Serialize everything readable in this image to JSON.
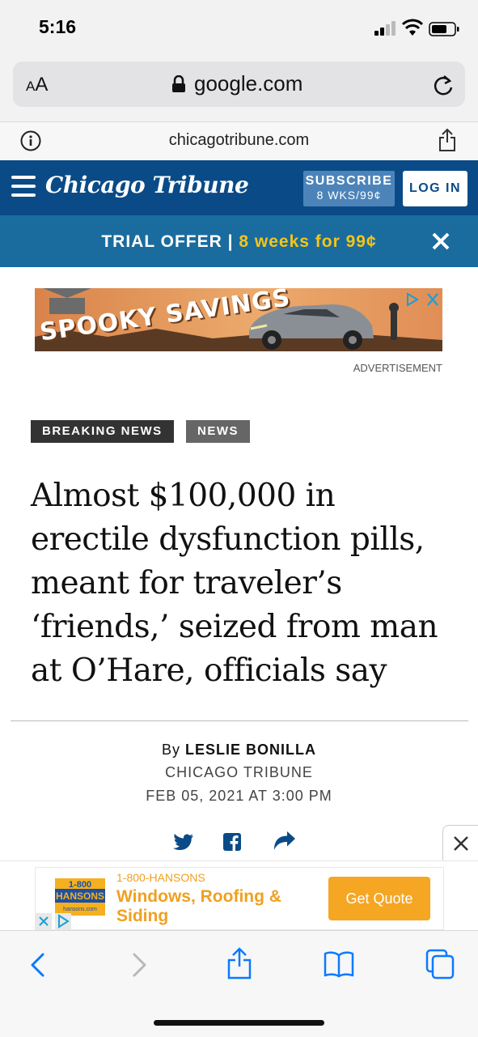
{
  "status_bar": {
    "time": "5:16"
  },
  "address_bar": {
    "aa_label_small": "A",
    "aa_label_large": "A",
    "url": "google.com"
  },
  "site_bar": {
    "host": "chicagotribune.com"
  },
  "header": {
    "logo": "Chicago Tribune",
    "subscribe_line1": "SUBSCRIBE",
    "subscribe_line2": "8 WKS/99¢",
    "login_label": "LOG IN"
  },
  "trial_bar": {
    "label": "TRIAL OFFER",
    "separator": " | ",
    "offer": "8 weeks for 99¢"
  },
  "ad_top": {
    "headline": "SPOOKY SAVINGS",
    "label": "ADVERTISEMENT"
  },
  "tags": [
    "BREAKING NEWS",
    "NEWS"
  ],
  "article": {
    "headline": "Almost $100,000 in erectile dysfunction pills, meant for traveler’s ‘friends,’ seized from man at O’Hare, officials say",
    "byline_prefix": "By ",
    "author": "LESLIE BONILLA",
    "publisher": "CHICAGO TRIBUNE",
    "date": "FEB 05, 2021 AT 3:00 PM"
  },
  "sticky_ad": {
    "small_text": "1-800-HANSONS",
    "title": "Windows, Roofing & Siding",
    "cta": "Get Quote",
    "logo_line1": "1-800",
    "logo_line2": "HANSONS",
    "logo_line3": "hansons.com"
  },
  "colors": {
    "header_blue": "#0a4b87",
    "trial_blue": "#1a6c9e",
    "trial_highlight": "#f5c518",
    "cta_orange": "#f5a623",
    "ios_blue": "#0a7aff"
  }
}
